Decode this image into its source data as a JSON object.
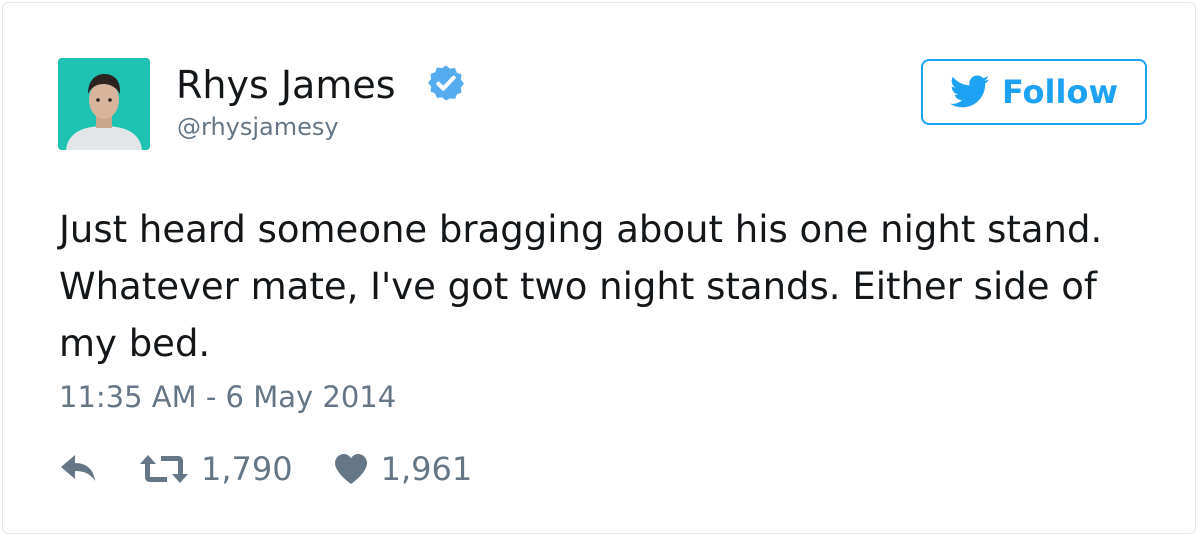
{
  "tweet": {
    "author_name": "Rhys James",
    "author_handle": "@rhysjamesy",
    "follow_label": "Follow",
    "text": "Just heard someone bragging about his one night stand. Whatever mate, I've got two night stands. Either side of my bed.",
    "timestamp": "11:35 AM - 6 May 2014",
    "retweet_count": "1,790",
    "like_count": "1,961"
  },
  "colors": {
    "accent": "#1da1f2",
    "verified": "#55acee",
    "text": "#14171a",
    "muted": "#657786",
    "avatar_bg": "#1ec2b0"
  },
  "icons": [
    "verified-icon",
    "twitter-bird-icon",
    "reply-icon",
    "retweet-icon",
    "heart-icon"
  ]
}
